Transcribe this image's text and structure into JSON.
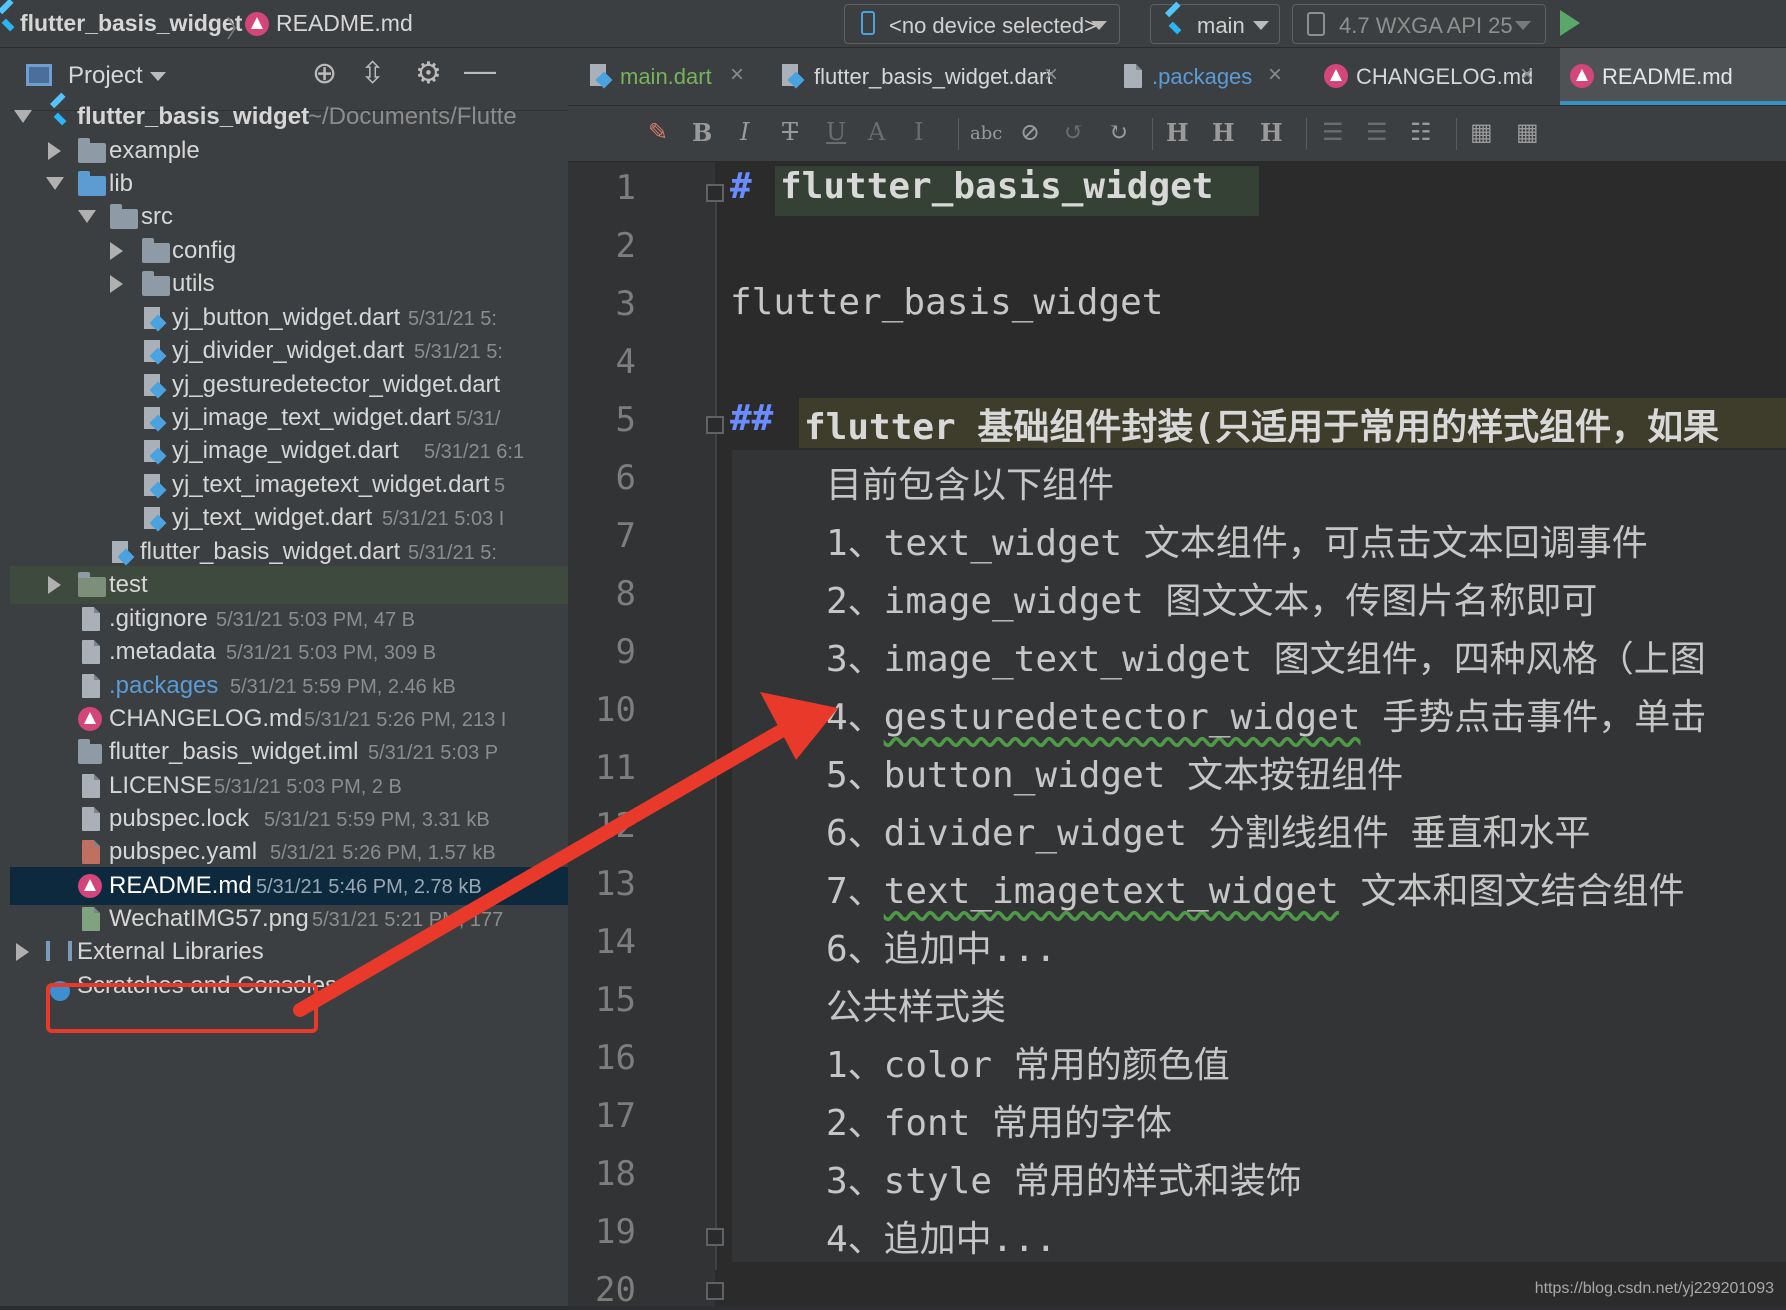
{
  "nav": {
    "project_name": "flutter_basis_widget",
    "file_name": "README.md",
    "device_selector": "<no device selected>",
    "config": "main",
    "emulator": "4.7  WXGA API 25"
  },
  "project_panel": {
    "title": "Project",
    "root_label": "flutter_basis_widget",
    "root_path": "~/Documents/Flutte",
    "items": [
      {
        "label": "example"
      },
      {
        "label": "lib"
      },
      {
        "label": "src"
      },
      {
        "label": "config"
      },
      {
        "label": "utils"
      },
      {
        "label": "yj_button_widget.dart",
        "meta": "5/31/21 5:"
      },
      {
        "label": "yj_divider_widget.dart",
        "meta": "5/31/21 5:"
      },
      {
        "label": "yj_gesturedetector_widget.dart",
        "meta": ""
      },
      {
        "label": "yj_image_text_widget.dart",
        "meta": "5/31/"
      },
      {
        "label": "yj_image_widget.dart",
        "meta": "5/31/21 6:1"
      },
      {
        "label": "yj_text_imagetext_widget.dart",
        "meta": "5"
      },
      {
        "label": "yj_text_widget.dart",
        "meta": "5/31/21 5:03 I"
      },
      {
        "label": "flutter_basis_widget.dart",
        "meta": "5/31/21 5:"
      },
      {
        "label": "test"
      },
      {
        "label": ".gitignore",
        "meta": "5/31/21 5:03 PM, 47 B"
      },
      {
        "label": ".metadata",
        "meta": "5/31/21 5:03 PM, 309 B"
      },
      {
        "label": ".packages",
        "meta": "5/31/21 5:59 PM, 2.46 kB"
      },
      {
        "label": "CHANGELOG.md",
        "meta": "5/31/21 5:26 PM, 213 I"
      },
      {
        "label": "flutter_basis_widget.iml",
        "meta": "5/31/21 5:03 P"
      },
      {
        "label": "LICENSE",
        "meta": "5/31/21 5:03 PM, 2 B"
      },
      {
        "label": "pubspec.lock",
        "meta": "5/31/21 5:59 PM, 3.31 kB"
      },
      {
        "label": "pubspec.yaml",
        "meta": "5/31/21 5:26 PM, 1.57 kB"
      },
      {
        "label": "README.md",
        "meta": "5/31/21 5:46 PM, 2.78 kB"
      },
      {
        "label": "WechatIMG57.png",
        "meta": "5/31/21 5:21 PM, 177"
      },
      {
        "label": "External Libraries"
      },
      {
        "label": "Scratches and Consoles"
      }
    ]
  },
  "tabs": [
    "main.dart",
    "flutter_basis_widget.dart",
    ".packages",
    "CHANGELOG.md",
    "README.md"
  ],
  "toolbar": {
    "bold": "B",
    "italic": "I",
    "strike": "T",
    "underline": "U",
    "sup": "A",
    "sub": "I",
    "h_up": "H",
    "h_down": "H",
    "h_mix": "H"
  },
  "editor": {
    "line_numbers": [
      "1",
      "2",
      "3",
      "4",
      "5",
      "6",
      "7",
      "8",
      "9",
      "10",
      "11",
      "12",
      "13",
      "14",
      "15",
      "16",
      "17",
      "18",
      "19",
      "20"
    ],
    "lines": [
      "# ",
      "flutter_basis_widget",
      "",
      "flutter_basis_widget",
      "## ",
      "flutter 基础组件封装(只适用于常用的样式组件，如果",
      "目前包含以下组件",
      "1、text_widget 文本组件，可点击文本回调事件",
      "2、image_widget 图文文本，传图片名称即可",
      "3、image_text_widget 图文组件，四种风格（上图",
      "4、",
      "gesturedetector_widget",
      " 手势点击事件，单击",
      "5、button_widget 文本按钮组件",
      "6、divider_widget 分割线组件 垂直和水平",
      "7、",
      "text_imagetext_widget",
      " 文本和图文结合组件",
      "6、追加中...",
      "公共样式类",
      "1、color 常用的颜色值",
      "2、font  常用的字体",
      "3、style 常用的样式和装饰",
      "4、追加中..."
    ]
  },
  "watermark": "https://blog.csdn.net/yj229201093",
  "colors": {
    "accent": "#3592c4",
    "selection": "#0d293e",
    "annotation": "#e8392a",
    "heading_hash": "#6b8cff"
  }
}
